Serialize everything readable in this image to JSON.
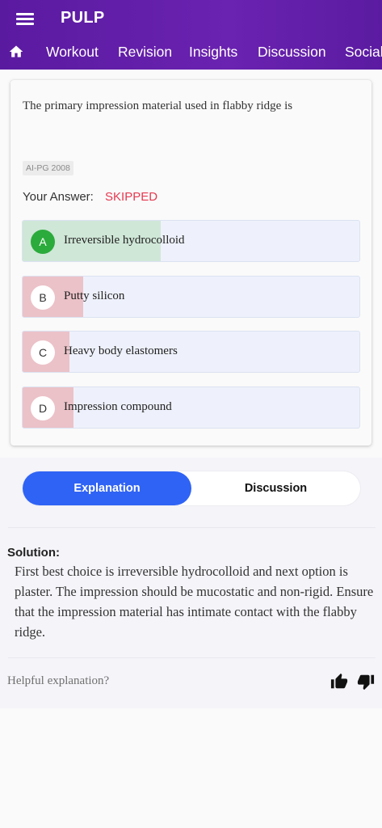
{
  "header": {
    "app_title": "PULP",
    "menu_icon": "hamburger-menu-icon",
    "home_icon": "home-icon",
    "tabs": [
      {
        "label": "Workout"
      },
      {
        "label": "Revision"
      },
      {
        "label": "Insights"
      },
      {
        "label": "Discussion"
      },
      {
        "label": "Social"
      }
    ],
    "colors": {
      "bar": "#5a1aa0"
    }
  },
  "question": {
    "text": "The primary impression material used in flabby ridge is",
    "tag": "AI-PG 2008",
    "your_answer_label": "Your Answer:",
    "your_answer_value": "SKIPPED",
    "options": [
      {
        "letter": "A",
        "text": "Irreversible hydrocolloid",
        "correct": true,
        "response_share": 0.41
      },
      {
        "letter": "B",
        "text": "Putty silicon",
        "correct": false,
        "response_share": 0.18
      },
      {
        "letter": "C",
        "text": "Heavy body elastomers",
        "correct": false,
        "response_share": 0.14
      },
      {
        "letter": "D",
        "text": "Impression compound",
        "correct": false,
        "response_share": 0.15
      }
    ],
    "colors": {
      "correct_fill": "#cfe7d7",
      "correct_badge": "#2bab3c",
      "wrong_fill": "#ebc2c8",
      "skipped": "#e53950"
    }
  },
  "toggle": {
    "explanation_label": "Explanation",
    "discussion_label": "Discussion",
    "active": "Explanation",
    "active_color": "#2f63f5"
  },
  "solution": {
    "title": "Solution:",
    "text": "First best choice is irreversible hydrocolloid and next option is plaster. The impression should be mucostatic and non-rigid. Ensure that the impression material has intimate contact with the flabby ridge."
  },
  "feedback": {
    "prompt": "Helpful explanation?",
    "up_icon": "thumbs-up-icon",
    "down_icon": "thumbs-down-icon"
  }
}
